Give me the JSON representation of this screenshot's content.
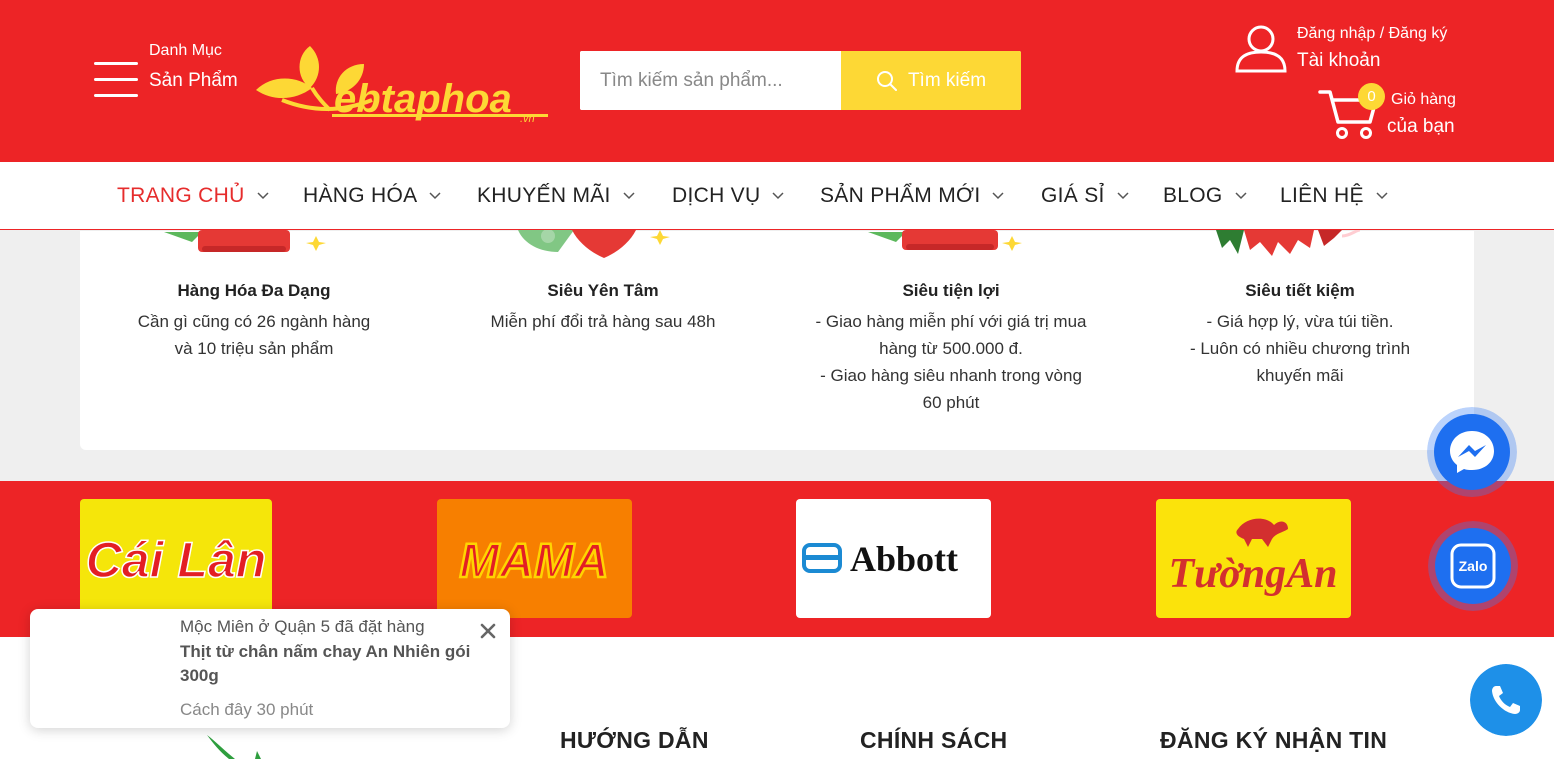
{
  "header": {
    "category_small": "Danh Mục",
    "category_big": "Sản Phẩm",
    "logo_text": "ebtaphoa",
    "logo_domain": ".vn",
    "search_placeholder": "Tìm kiếm sản phẩm...",
    "search_button": "Tìm kiếm",
    "account_small": "Đăng nhập / Đăng ký",
    "account_big": "Tài khoản",
    "cart_count": "0",
    "cart_small": "Giỏ hàng",
    "cart_big": "của bạn",
    "brand_color": "#ed2426",
    "accent_color": "#fdd835"
  },
  "nav": {
    "items": [
      {
        "label": "TRANG CHỦ",
        "active": true
      },
      {
        "label": "HÀNG HÓA"
      },
      {
        "label": "KHUYẾN MÃI"
      },
      {
        "label": "DỊCH VỤ"
      },
      {
        "label": "SẢN PHẨM MỚI"
      },
      {
        "label": "GIÁ SỈ"
      },
      {
        "label": "BLOG"
      },
      {
        "label": "LIÊN HỆ"
      }
    ]
  },
  "features": [
    {
      "title": "Hàng Hóa Đa Dạng",
      "lines": [
        "Cần gì cũng có 26 ngành hàng",
        "và 10 triệu sản phẩm"
      ]
    },
    {
      "title": "Siêu Yên Tâm",
      "lines": [
        "Miễn phí đổi trả hàng sau 48h"
      ]
    },
    {
      "title": "Siêu tiện lợi",
      "lines": [
        "- Giao hàng miễn phí với giá trị mua",
        "hàng từ 500.000 đ.",
        "- Giao hàng siêu nhanh trong vòng",
        "60 phút"
      ]
    },
    {
      "title": "Siêu tiết kiệm",
      "lines": [
        "- Giá hợp lý, vừa túi tiền.",
        "- Luôn có nhiều chương trình",
        "khuyến mãi"
      ]
    }
  ],
  "brands": [
    {
      "name": "Cái Lân"
    },
    {
      "name": "MAMA"
    },
    {
      "name": "Abbott"
    },
    {
      "name": "TườngAn"
    }
  ],
  "footer": {
    "headings": [
      "HƯỚNG DẪN",
      "CHÍNH SÁCH",
      "ĐĂNG KÝ NHẬN TIN"
    ]
  },
  "popup": {
    "line1": "Mộc Miên ở Quận 5 đã đặt hàng",
    "product": "Thịt từ chân nấm chay An Nhiên gói 300g",
    "time": "Cách đây 30 phút"
  },
  "floating": {
    "zalo_label": "Zalo",
    "icons": [
      "messenger-icon",
      "zalo-icon",
      "phone-icon"
    ]
  }
}
